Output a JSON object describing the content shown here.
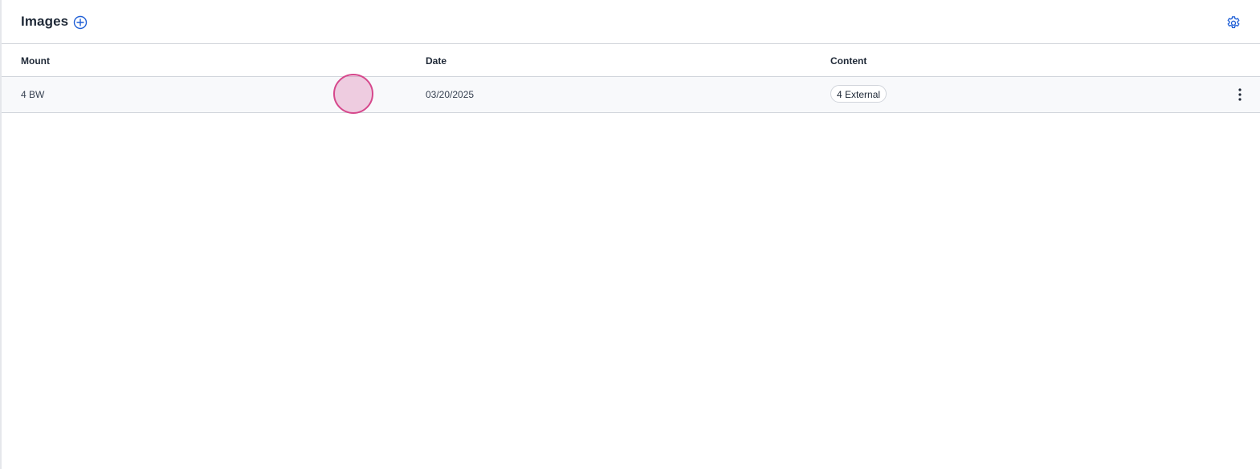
{
  "header": {
    "title": "Images",
    "add_icon": "plus-circle-icon",
    "settings_icon": "gear-icon"
  },
  "table": {
    "columns": [
      "Mount",
      "Date",
      "Content"
    ],
    "rows": [
      {
        "mount": "4 BW",
        "date": "03/20/2025",
        "content": "4 External",
        "menu_icon": "kebab-menu-icon"
      }
    ]
  },
  "colors": {
    "accent": "#1f5fd6",
    "row_bg": "#f8f9fb",
    "border": "#d1d5db",
    "click_marker": "#d6488c"
  }
}
